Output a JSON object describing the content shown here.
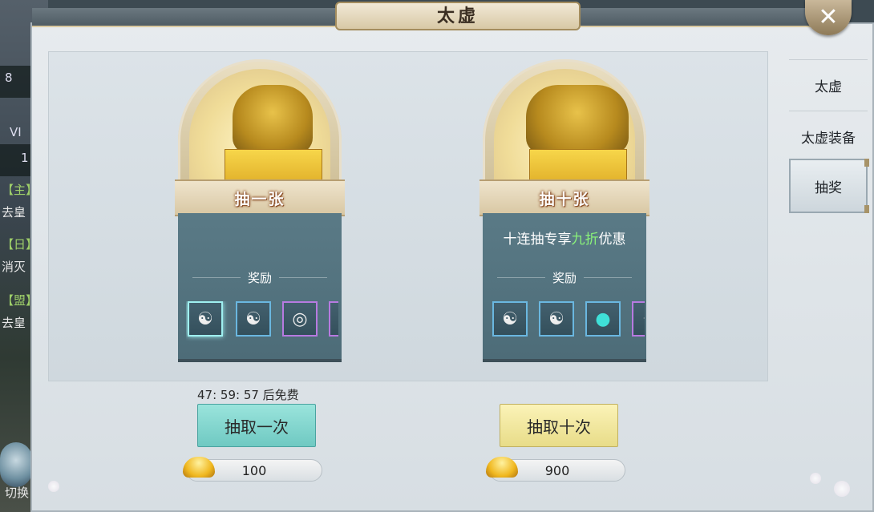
{
  "window": {
    "title": "太虚",
    "close_icon": "close-icon"
  },
  "background": {
    "chips": [
      "8",
      "VI",
      "1"
    ],
    "chat": [
      {
        "tag": "【主】",
        "text": "去皇"
      },
      {
        "tag": "【日】",
        "text": "消灭"
      },
      {
        "tag": "【盟】",
        "text": "去皇"
      }
    ],
    "switch_label": "切换"
  },
  "tabs": [
    {
      "label": "太虚",
      "active": false
    },
    {
      "label": "太虚装备",
      "active": false
    },
    {
      "label": "抽奖",
      "active": true
    }
  ],
  "cards": [
    {
      "ribbon": "抽一张",
      "promo": "",
      "reward_label": "奖励",
      "items": [
        {
          "icon": "taiji-bracelet-icon",
          "glyph": "☯",
          "border": "blue",
          "selected": true
        },
        {
          "icon": "taiji-pendant-icon",
          "glyph": "☯",
          "border": "blue",
          "selected": false
        },
        {
          "icon": "ring-icon",
          "glyph": "◎",
          "border": "purple",
          "selected": false
        },
        {
          "icon": "charm-icon",
          "glyph": "✦",
          "border": "purple",
          "selected": false
        }
      ]
    },
    {
      "ribbon": "抽十张",
      "promo_prefix": "十连抽专享",
      "promo_highlight": "九折",
      "promo_suffix": "优惠",
      "reward_label": "奖励",
      "items": [
        {
          "icon": "boots-icon",
          "glyph": "☯",
          "border": "blue",
          "selected": false
        },
        {
          "icon": "belt-icon",
          "glyph": "☯",
          "border": "blue",
          "selected": false
        },
        {
          "icon": "orb-icon",
          "glyph": "●",
          "border": "blue",
          "selected": false
        },
        {
          "icon": "charm-icon",
          "glyph": "✦",
          "border": "purple",
          "selected": false
        }
      ]
    }
  ],
  "draw_one": {
    "timer": "47: 59: 57 后免费",
    "button": "抽取一次",
    "cost": "100",
    "currency_icon": "gold-ingot-icon"
  },
  "draw_ten": {
    "button": "抽取十次",
    "cost": "900",
    "currency_icon": "gold-ingot-icon"
  },
  "colors": {
    "teal_button": "#8fdcd5",
    "yellow_button": "#f4eca6",
    "promo_highlight": "#8af27a",
    "card_body": "#547480"
  }
}
